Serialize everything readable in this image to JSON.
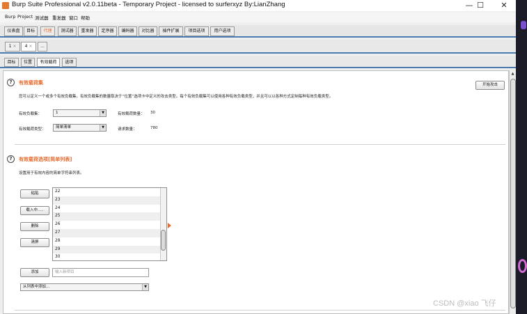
{
  "window": {
    "title": "Burp Suite Professional v2.0.11beta - Temporary Project - licensed to surferxyz By:LianZhang",
    "controls": {
      "minimize": "—",
      "maximize": "☐",
      "close": "✕"
    }
  },
  "menu": [
    "Burp",
    "Project",
    "测试器",
    "重发器",
    "窗口",
    "帮助"
  ],
  "main_tabs": [
    "仪表盘",
    "目标",
    "代理",
    "测试器",
    "重发器",
    "定序器",
    "编码器",
    "对比器",
    "插件扩展",
    "项目选项",
    "用户选项"
  ],
  "main_tabs_active": "测试器",
  "request_tabs": [
    {
      "label": "1",
      "close": "×"
    },
    {
      "label": "4",
      "close": "×"
    },
    {
      "label": "..."
    }
  ],
  "sub_tabs": [
    "目标",
    "位置",
    "有效载荷",
    "选项"
  ],
  "sub_tabs_active": "有效载荷",
  "payload_sets": {
    "help_icon": "?",
    "title": "有效载荷集",
    "description": "您可以定义一个或多个有效负载集。有效负载集的数量取决于“位置”选项卡中定义的攻击类型。每个有效负载集可以使用各种有效负载类型，并且可以以各种方式定制每种有效负载类型。",
    "start_attack": "开始攻击",
    "set_label": "有效负载集：",
    "set_value": "1",
    "count_label": "有效载荷数量：",
    "count_value": "30",
    "type_label": "有效载荷类型：",
    "type_value": "简单清单",
    "requests_label": "请求数量：",
    "requests_value": "780"
  },
  "payload_options": {
    "help_icon": "?",
    "title": "有效载荷选项[简单列表]",
    "description": "设置用于有效内容的简单字符串列表。",
    "buttons": {
      "paste": "粘贴",
      "load": "载入中.....",
      "remove": "删除",
      "clear": "清屏",
      "add": "添加"
    },
    "list_items": [
      "22",
      "23",
      "24",
      "25",
      "26",
      "27",
      "28",
      "29",
      "30"
    ],
    "add_placeholder": "输入新项目",
    "add_from_list": "从列表中添加..."
  },
  "watermark": "CSDN @xiao 飞仔",
  "icons": {
    "app": "burp-icon",
    "dropdown": "chevron-down-icon",
    "scroll_up": "chevron-up-icon"
  },
  "colors": {
    "accent": "#e8692b",
    "tab_border": "#4a7bb0"
  }
}
